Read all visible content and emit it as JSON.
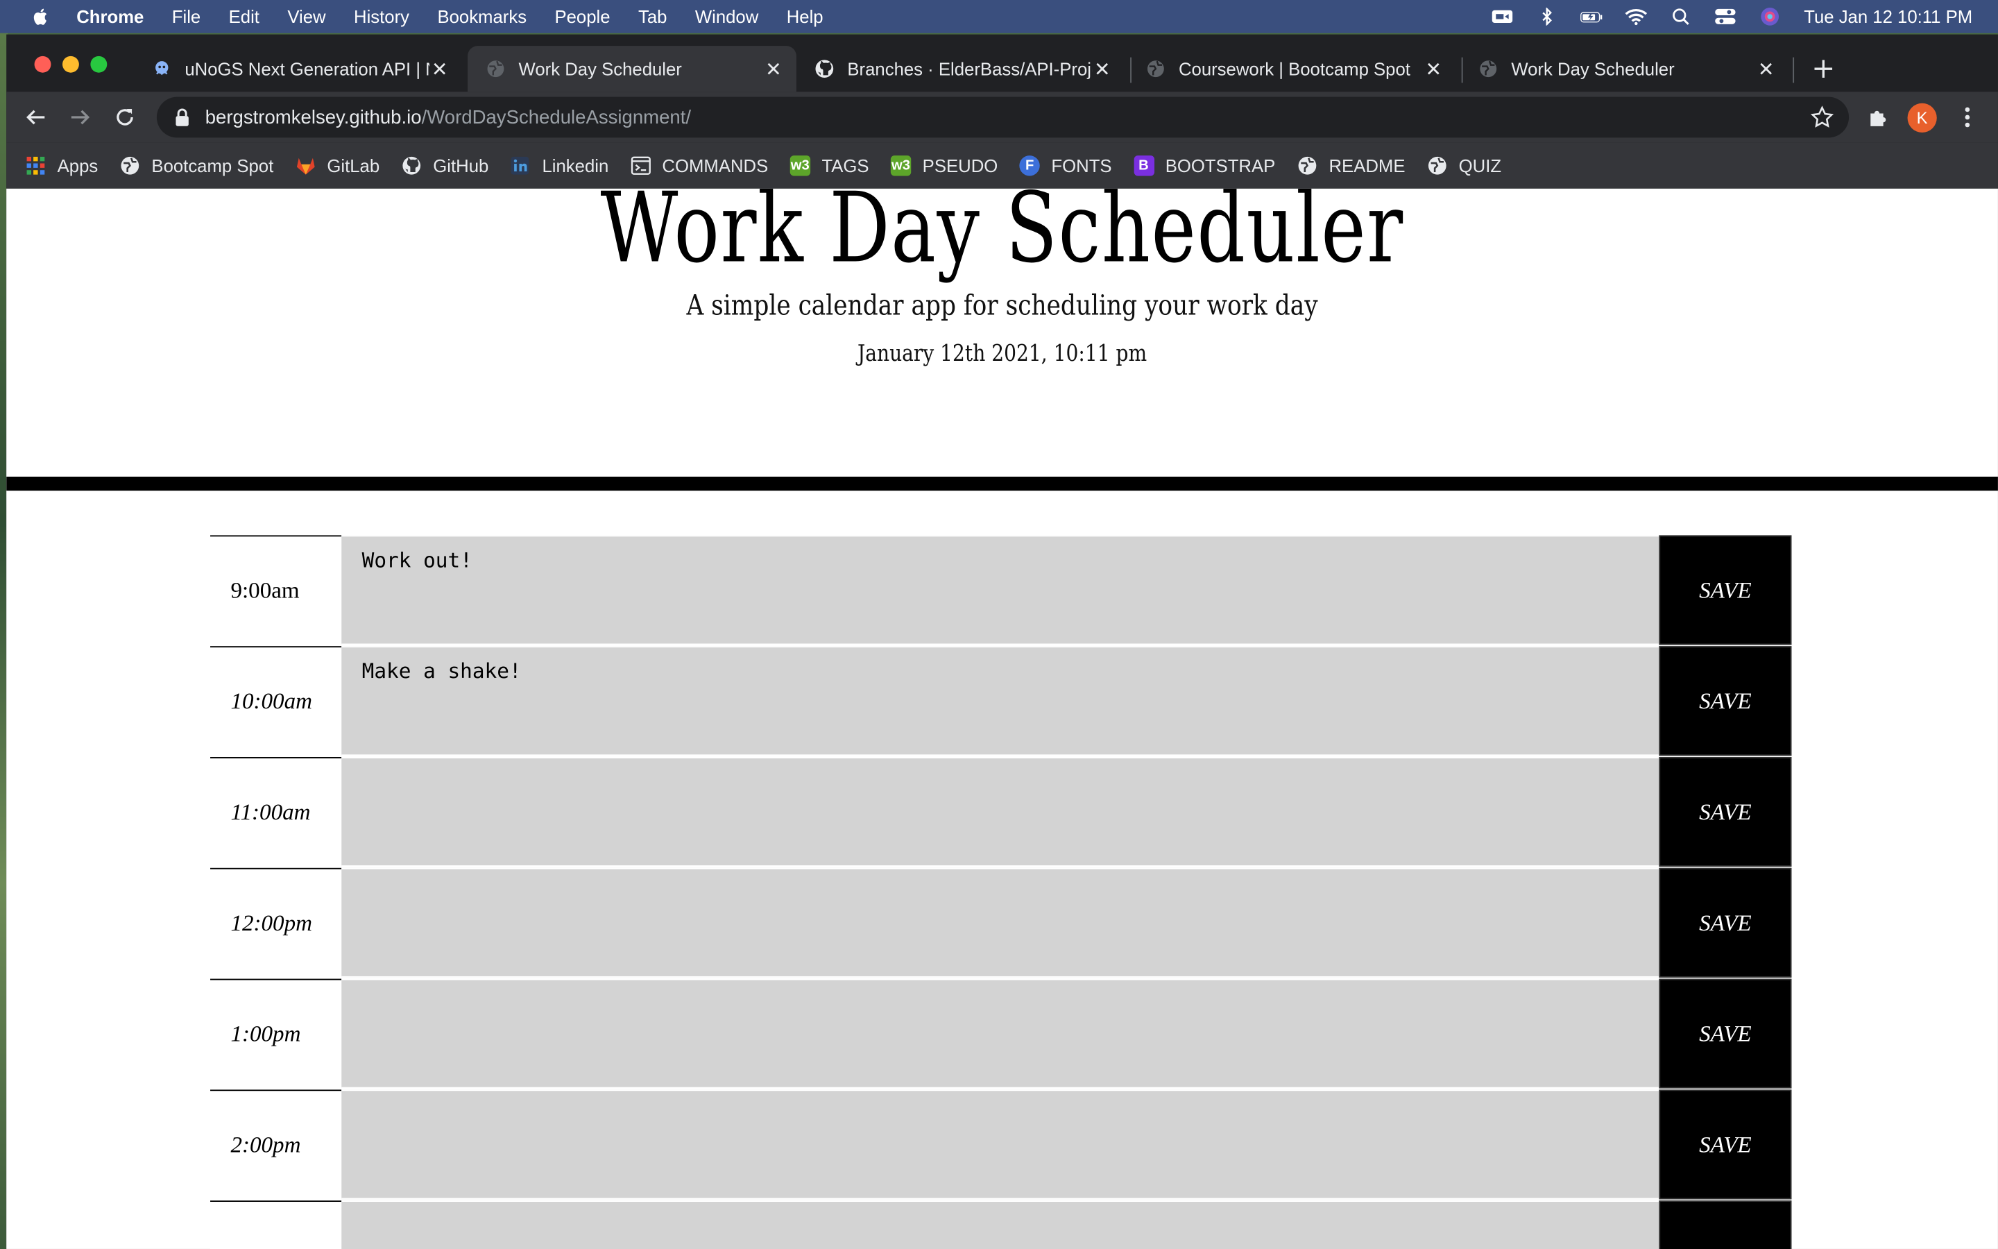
{
  "menubar": {
    "app_name": "Chrome",
    "items": [
      "File",
      "Edit",
      "View",
      "History",
      "Bookmarks",
      "People",
      "Tab",
      "Window",
      "Help"
    ],
    "clock": "Tue Jan 12  10:11 PM"
  },
  "tabs": [
    {
      "title": "uNoGS Next Generation API | N",
      "active": false
    },
    {
      "title": "Work Day Scheduler",
      "active": true
    },
    {
      "title": "Branches · ElderBass/API-Proje",
      "active": false
    },
    {
      "title": "Coursework | Bootcamp Spot",
      "active": false
    },
    {
      "title": "Work Day Scheduler",
      "active": false
    }
  ],
  "address_bar": {
    "domain": "bergstromkelsey.github.io",
    "path": "/WordDayScheduleAssignment/"
  },
  "profile": {
    "initial": "K",
    "color": "#e8602c"
  },
  "bookmarks": [
    {
      "label": "Apps",
      "icon": "apps-grid-icon"
    },
    {
      "label": "Bootcamp Spot",
      "icon": "globe-icon"
    },
    {
      "label": "GitLab",
      "icon": "gitlab-icon"
    },
    {
      "label": "GitHub",
      "icon": "github-icon"
    },
    {
      "label": "Linkedin",
      "icon": "linkedin-icon"
    },
    {
      "label": "COMMANDS",
      "icon": "terminal-icon"
    },
    {
      "label": "TAGS",
      "icon": "w3-icon"
    },
    {
      "label": "PSEUDO",
      "icon": "w3-icon"
    },
    {
      "label": "FONTS",
      "icon": "f-icon"
    },
    {
      "label": "BOOTSTRAP",
      "icon": "bootstrap-icon"
    },
    {
      "label": "README",
      "icon": "globe-icon"
    },
    {
      "label": "QUIZ",
      "icon": "globe-icon"
    }
  ],
  "page": {
    "title": "Work Day Scheduler",
    "lead": "A simple calendar app for scheduling your work day",
    "current_day": "January 12th 2021, 10:11 pm",
    "save_label": "SAVE",
    "hours": [
      {
        "label": "9:00am",
        "text": "Work out!"
      },
      {
        "label": "10:00am",
        "text": "Make a shake!"
      },
      {
        "label": "11:00am",
        "text": ""
      },
      {
        "label": "12:00pm",
        "text": ""
      },
      {
        "label": "1:00pm",
        "text": ""
      },
      {
        "label": "2:00pm",
        "text": ""
      },
      {
        "label": "",
        "text": ""
      }
    ]
  },
  "colors": {
    "menubar": "#3a4f7e",
    "description_bg": "#d3d3d3",
    "save_bg": "#000000"
  }
}
